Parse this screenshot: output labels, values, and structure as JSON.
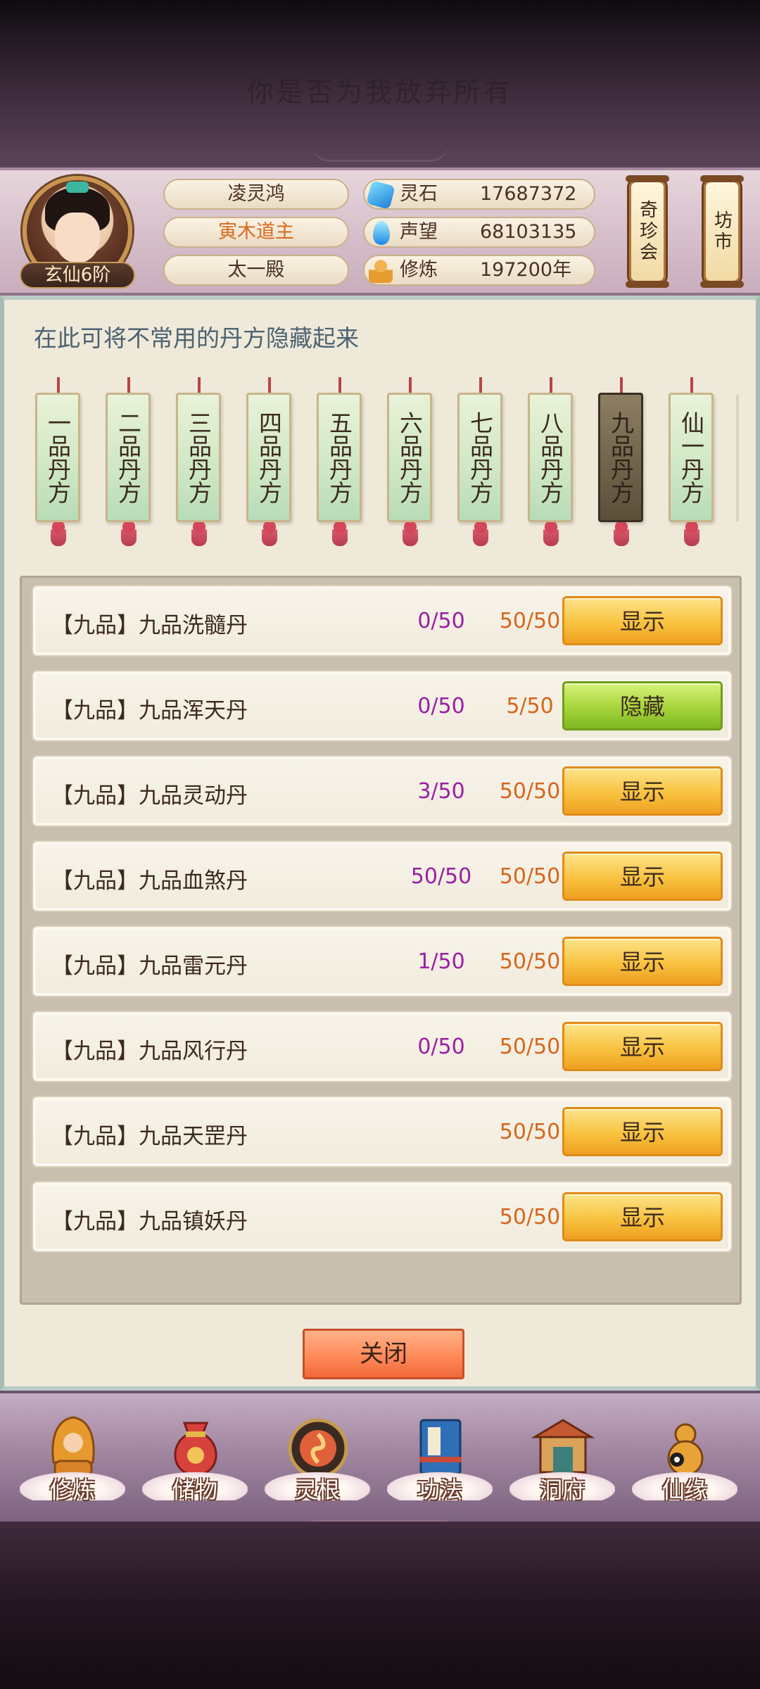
{
  "top": {
    "title": "你是否为我放弃所有"
  },
  "header": {
    "rank": "玄仙6阶",
    "name": "凌灵鸿",
    "title": "寅木道主",
    "sect": "太一殿",
    "stats": [
      {
        "icon": "spirit-stone-icon",
        "label": "灵石",
        "value": "17687372"
      },
      {
        "icon": "reputation-drop-icon",
        "label": "声望",
        "value": "68103135"
      },
      {
        "icon": "cultivation-monk-icon",
        "label": "修炼",
        "value": "197200年"
      }
    ],
    "shortcuts": [
      {
        "label": "奇珍会"
      },
      {
        "label": "坊市"
      }
    ]
  },
  "panel": {
    "hint": "在此可将不常用的丹方隐藏起来",
    "tabs": [
      {
        "label": "一品丹方",
        "active": false
      },
      {
        "label": "二品丹方",
        "active": false
      },
      {
        "label": "三品丹方",
        "active": false
      },
      {
        "label": "四品丹方",
        "active": false
      },
      {
        "label": "五品丹方",
        "active": false
      },
      {
        "label": "六品丹方",
        "active": false
      },
      {
        "label": "七品丹方",
        "active": false
      },
      {
        "label": "八品丹方",
        "active": false
      },
      {
        "label": "九品丹方",
        "active": true
      },
      {
        "label": "仙一丹方",
        "active": false
      }
    ],
    "recipes": [
      {
        "name": "【九品】九品洗髓丹",
        "progress": "0/50",
        "count": "50/50",
        "action": "显示",
        "state": "show"
      },
      {
        "name": "【九品】九品浑天丹",
        "progress": "0/50",
        "count": "5/50",
        "action": "隐藏",
        "state": "hide"
      },
      {
        "name": "【九品】九品灵动丹",
        "progress": "3/50",
        "count": "50/50",
        "action": "显示",
        "state": "show"
      },
      {
        "name": "【九品】九品血煞丹",
        "progress": "50/50",
        "count": "50/50",
        "action": "显示",
        "state": "show"
      },
      {
        "name": "【九品】九品雷元丹",
        "progress": "1/50",
        "count": "50/50",
        "action": "显示",
        "state": "show"
      },
      {
        "name": "【九品】九品风行丹",
        "progress": "0/50",
        "count": "50/50",
        "action": "显示",
        "state": "show"
      },
      {
        "name": "【九品】九品天罡丹",
        "progress": "",
        "count": "50/50",
        "action": "显示",
        "state": "show"
      },
      {
        "name": "【九品】九品镇妖丹",
        "progress": "",
        "count": "50/50",
        "action": "显示",
        "state": "show"
      }
    ],
    "close_label": "关闭"
  },
  "nav": [
    {
      "label": "修炼",
      "icon": "hooded-monk-icon"
    },
    {
      "label": "储物",
      "icon": "treasure-bag-icon"
    },
    {
      "label": "灵根",
      "icon": "spirit-root-icon"
    },
    {
      "label": "功法",
      "icon": "scripture-book-icon"
    },
    {
      "label": "洞府",
      "icon": "cave-palace-icon"
    },
    {
      "label": "仙缘",
      "icon": "gourd-icon"
    }
  ],
  "colors": {
    "progress_purple": "#9a1fa3",
    "count_orange": "#d7651b",
    "show_button": "#f8c33f",
    "hide_button": "#a5d43a"
  }
}
